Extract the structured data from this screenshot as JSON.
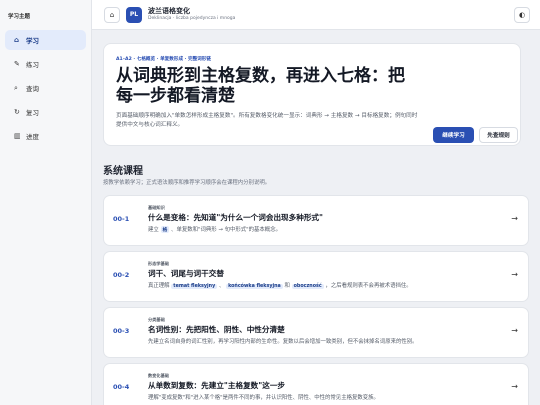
{
  "sidebar": {
    "brand": "学习主题",
    "items": [
      {
        "icon": "⌂",
        "label": "学习",
        "active": true
      },
      {
        "icon": "✎",
        "label": "练习"
      },
      {
        "icon": "⌕",
        "label": "查询"
      },
      {
        "icon": "↻",
        "label": "复习"
      },
      {
        "icon": "▥",
        "label": "进度"
      }
    ]
  },
  "topbar": {
    "home_icon": "⌂",
    "avatar": "PL",
    "title": "波兰语格变化",
    "subtitle": "Deklinacja · liczba pojedyncza i mnoga",
    "theme_icon": "◐"
  },
  "hero": {
    "eyebrow": "A1–A2 · 七格概览 · 单复数形成 · 完整词形链",
    "title": "从词典形到主格复数，再进入七格：把每一步都看清楚",
    "description": "页面基础顺序明确加入\"单数怎样形成主格复数\"。所有复数格变化统一显示：词典形 → 主格复数 → 目标格复数；例句同时提供中文与核心词汇释义。",
    "primary_button": "继续学习",
    "secondary_button": "先查规则"
  },
  "section": {
    "title": "系统课程",
    "subtitle": "按教学依赖学习；正式语法顺序和推荐学习顺序会在课程内分别说明。"
  },
  "courses": [
    {
      "code": "00-1",
      "tag": "基础知识",
      "title": "什么是变格：先知道\"为什么一个词会出现多种形式\"",
      "desc_a": "建立",
      "chip1": "格",
      "desc_b": "、单复数和\"词典形 → 句中形式\"的基本概念。",
      "arrow": "→"
    },
    {
      "code": "00-2",
      "tag": "形态学基础",
      "title": "词干、词尾与词干交替",
      "desc_a": "真正理解",
      "chip1": "temat fleksyjny",
      "desc_b": "、",
      "chip2": "końcówka fleksyjna",
      "desc_c": "和",
      "chip3": "oboczność",
      "desc_d": "，之后看规则表不会再被术语挡住。",
      "arrow": "→"
    },
    {
      "code": "00-3",
      "tag": "分类基础",
      "title": "名词性别：先把阳性、阴性、中性分清楚",
      "desc_a": "先建立名词自身的词汇性别，再学习阳性内部的生命性。复数以后会增加一致类别，但不会抹掉名词原来的性别。",
      "arrow": "→"
    },
    {
      "code": "00-4",
      "tag": "数变化基础",
      "title": "从单数到复数：先建立\"主格复数\"这一步",
      "desc_a": "理解\"变成复数\"和\"进入某个格\"是两件不同的事，并认识阳性、阴性、中性的常见主格复数变族。",
      "arrow": "→"
    }
  ]
}
